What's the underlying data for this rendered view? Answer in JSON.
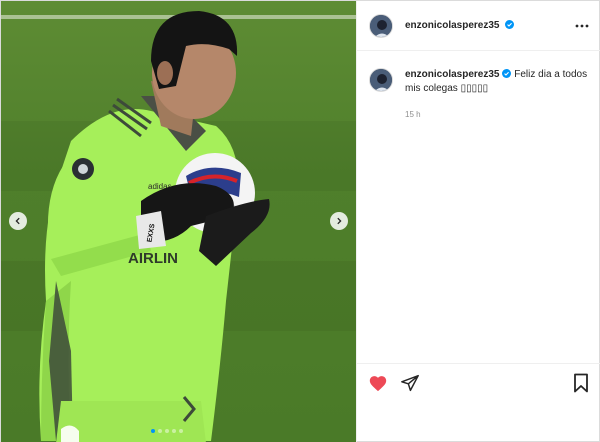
{
  "post": {
    "username": "enzonicolasperez35",
    "caption": "Feliz dia a todos mis colegas ▯▯▯▯▯",
    "timestamp": "15 h",
    "liked": true,
    "carousel": {
      "total": 5,
      "current": 1
    }
  },
  "photo": {
    "jersey_text": "AIRLIN",
    "glove_text": "EXXS"
  },
  "colors": {
    "like": "#ed4956",
    "verified": "#0095f6",
    "jersey": "#a7f25b",
    "field": "#4f7f2b"
  },
  "icons": [
    "more-options-icon",
    "verified-badge-icon",
    "heart-icon",
    "share-icon",
    "bookmark-icon",
    "chevron-left-icon",
    "chevron-right-icon"
  ]
}
